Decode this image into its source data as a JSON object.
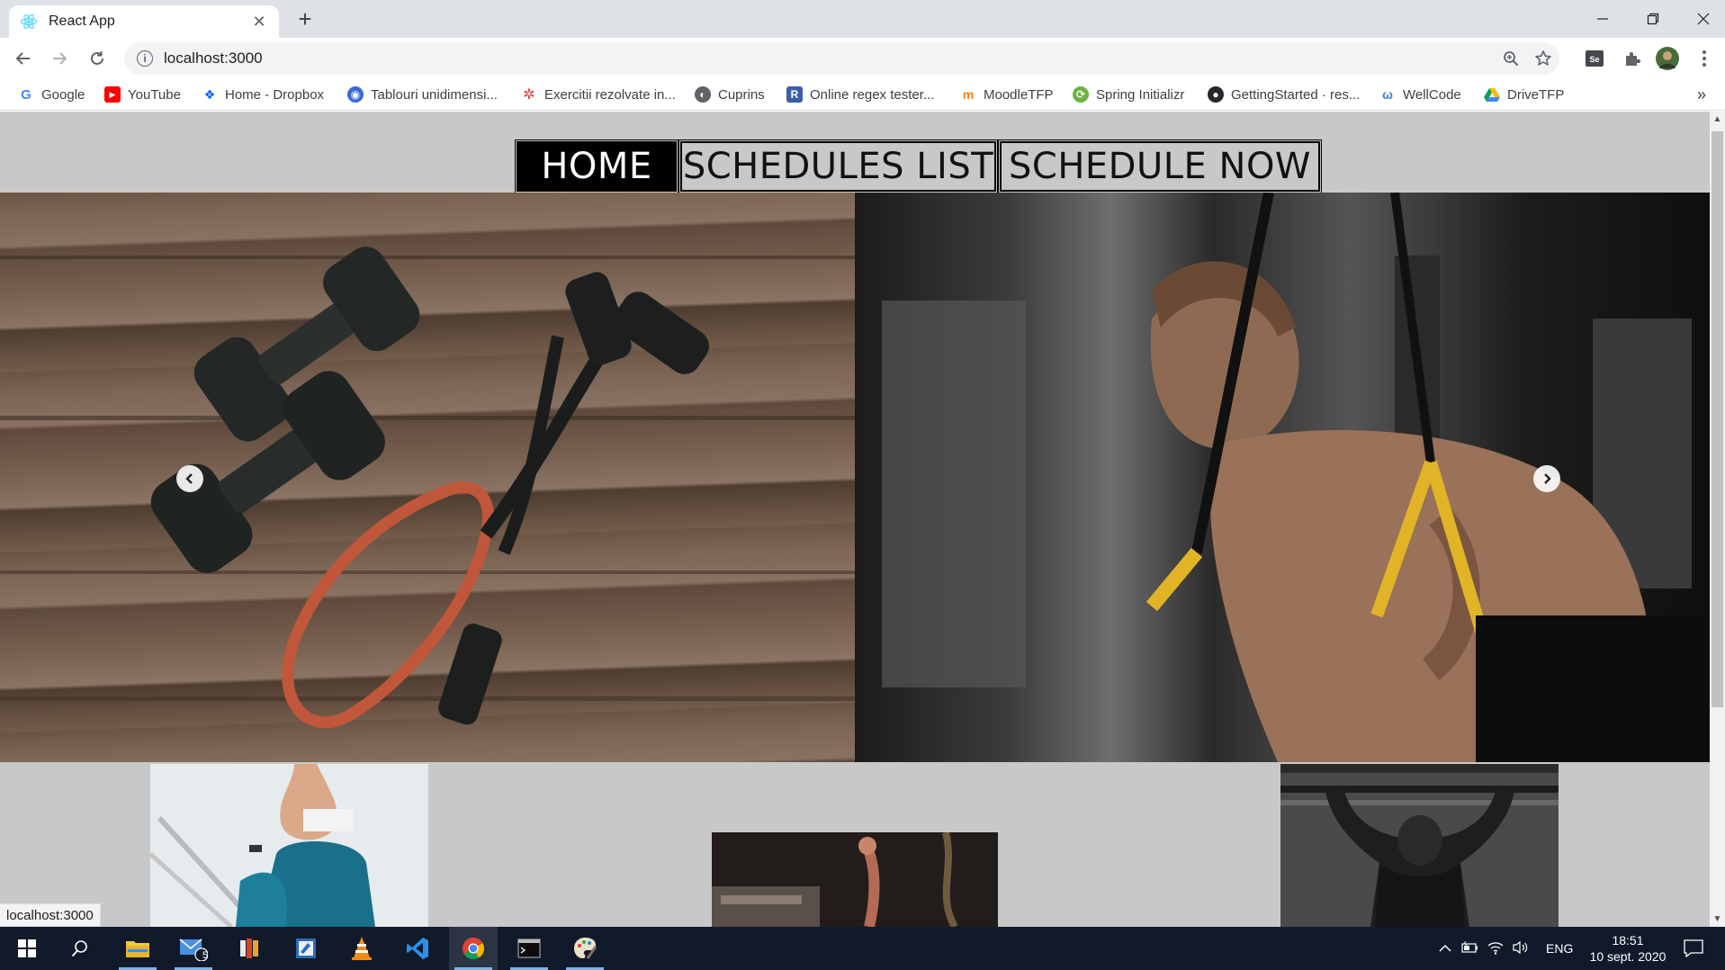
{
  "browser": {
    "tab_title": "React App",
    "url": "localhost:3000",
    "bookmarks": [
      {
        "label": "Google",
        "icon": "google-icon",
        "color": "#4285f4"
      },
      {
        "label": "YouTube",
        "icon": "youtube-icon",
        "color": "#ff0000"
      },
      {
        "label": "Home - Dropbox",
        "icon": "dropbox-icon",
        "color": "#0061fe"
      },
      {
        "label": "Tablouri unidimensi...",
        "icon": "globe-icon",
        "color": "#3b6bd6"
      },
      {
        "label": "Exercitii rezolvate in...",
        "icon": "dots-icon",
        "color": "#e53935"
      },
      {
        "label": "Cuprins",
        "icon": "globe-icon",
        "color": "#5f6368"
      },
      {
        "label": "Online regex tester...",
        "icon": "regex-icon",
        "color": "#3b5ea8"
      },
      {
        "label": "MoodleTFP",
        "icon": "moodle-icon",
        "color": "#f98012"
      },
      {
        "label": "Spring Initializr",
        "icon": "spring-icon",
        "color": "#6db33f"
      },
      {
        "label": "GettingStarted · res...",
        "icon": "github-icon",
        "color": "#24292e"
      },
      {
        "label": "WellCode",
        "icon": "wellcode-icon",
        "color": "#3f7fd9"
      },
      {
        "label": "DriveTFP",
        "icon": "drive-icon",
        "color": "#0f9d58"
      }
    ]
  },
  "page": {
    "nav": {
      "home": "HOME",
      "schedules_list": "SCHEDULES LIST",
      "schedule_now": "SCHEDULE NOW"
    },
    "status_url": "localhost:3000"
  },
  "taskbar": {
    "language": "ENG",
    "time": "18:51",
    "date": "10 sept. 2020",
    "mail_badge": "5"
  }
}
